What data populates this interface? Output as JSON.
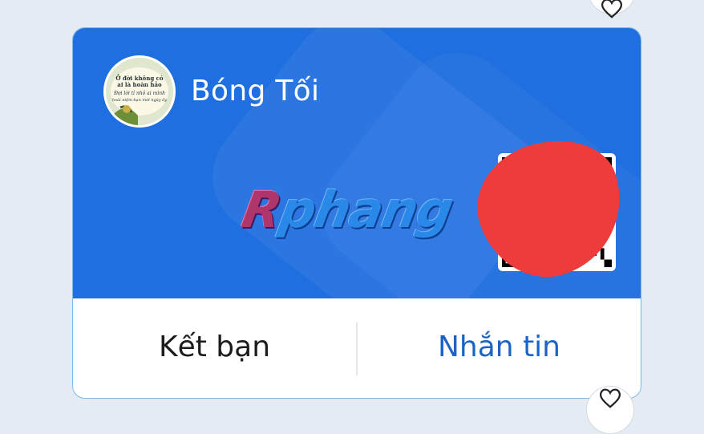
{
  "profile": {
    "name": "Bóng Tối",
    "avatar_lines": [
      "Ở đời không có",
      "ai là hoàn hảo",
      "Đợi lời tỉ nhỏ ai mình",
      "hoài niệm bạn mới ngày ấy"
    ]
  },
  "watermark": {
    "first_letter": "R",
    "rest": "phang"
  },
  "actions": {
    "add_friend": "Kết bạn",
    "message": "Nhắn tin"
  },
  "colors": {
    "card_blue": "#1f6fe0",
    "message_text": "#1d63c4",
    "redaction": "#ee3b3b"
  },
  "icons": {
    "favorite_top": "heart-icon",
    "favorite_bottom": "heart-icon"
  }
}
